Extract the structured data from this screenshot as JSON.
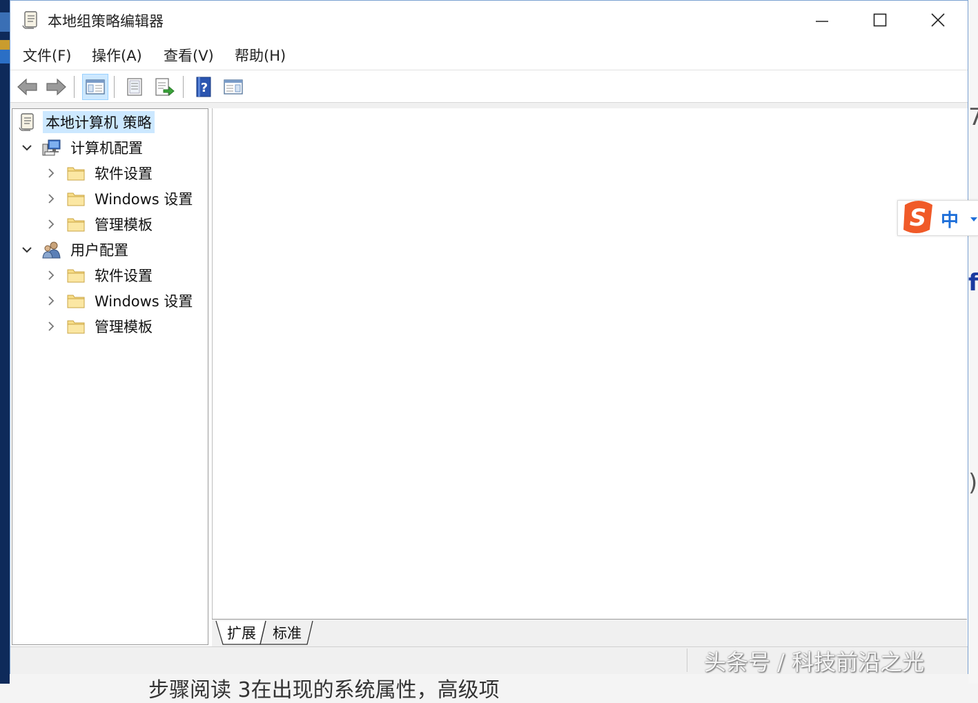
{
  "window": {
    "title": "本地组策略编辑器",
    "controls": {
      "minimize": "minimize",
      "maximize": "maximize",
      "close": "close"
    }
  },
  "menu": [
    "文件(F)",
    "操作(A)",
    "查看(V)",
    "帮助(H)"
  ],
  "toolbar": {
    "buttons": [
      "back-icon",
      "forward-icon",
      "show-hide-console-tree-icon",
      "properties-icon",
      "export-list-icon",
      "help-icon",
      "show-hide-action-pane-icon"
    ]
  },
  "tree": {
    "root": "本地计算机 策略",
    "computer_config": "计算机配置",
    "user_config": "用户配置",
    "cc_items": [
      "软件设置",
      "Windows 设置",
      "管理模板"
    ],
    "uc_items": [
      "软件设置",
      "Windows 设置",
      "管理模板"
    ]
  },
  "tabs": [
    "扩展",
    "标准"
  ],
  "ime": {
    "label": "中"
  },
  "watermark": "头条号 / 科技前沿之光",
  "background_text": "步骤阅读 3在出现的系统属性，高级项"
}
